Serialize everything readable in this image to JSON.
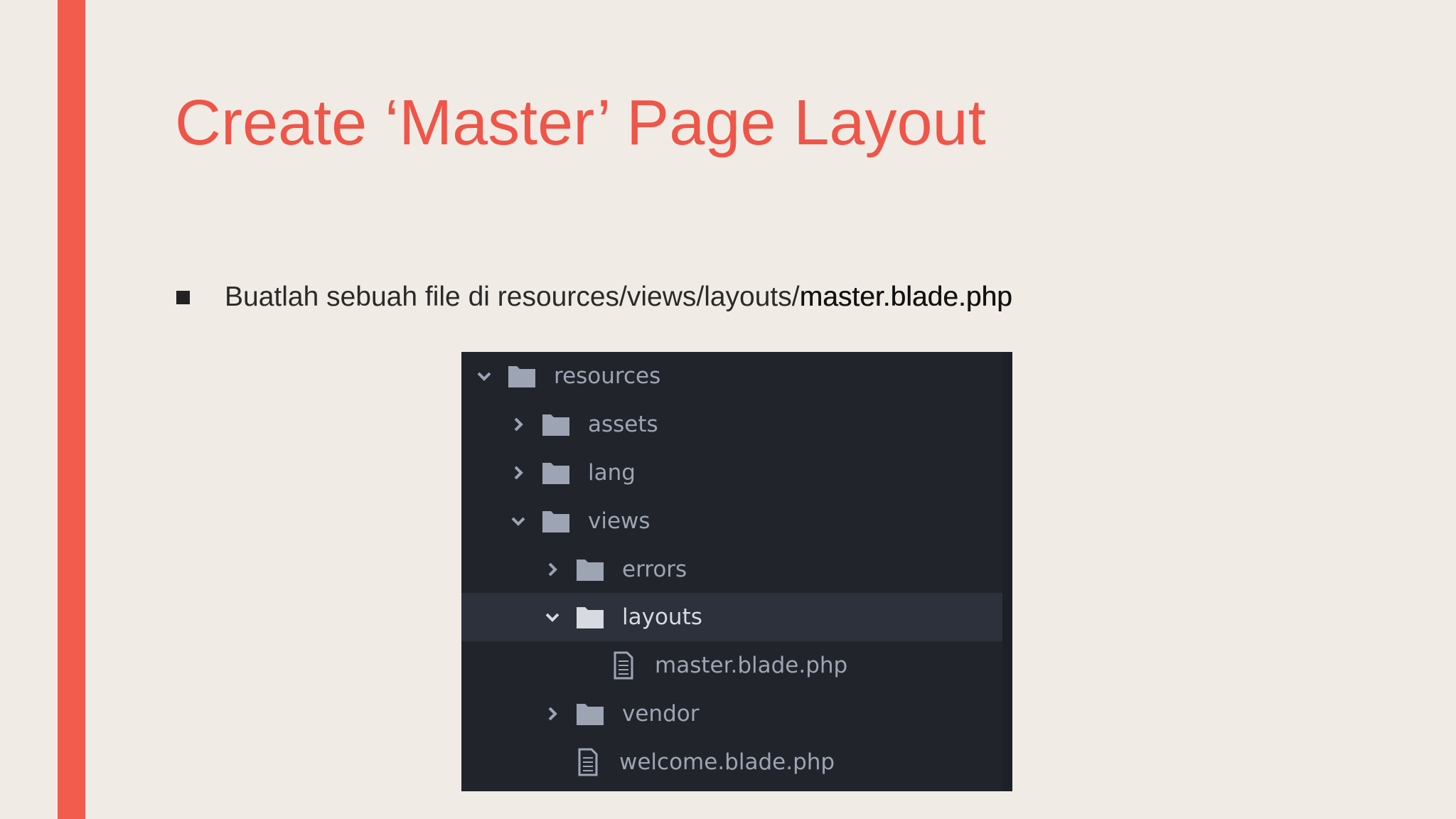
{
  "slide": {
    "title": "Create ‘Master’ Page Layout",
    "bullet": {
      "prefix": "Buatlah sebuah file di resources/views/layouts/",
      "emphasis": "master.blade.php"
    },
    "accent_color": "#f25c4c",
    "title_color": "#ef5548",
    "background_color": "#f0ece5"
  },
  "tree": {
    "items": [
      {
        "label": "resources",
        "type": "folder",
        "state": "expanded"
      },
      {
        "label": "assets",
        "type": "folder",
        "state": "collapsed"
      },
      {
        "label": "lang",
        "type": "folder",
        "state": "collapsed"
      },
      {
        "label": "views",
        "type": "folder",
        "state": "expanded"
      },
      {
        "label": "errors",
        "type": "folder",
        "state": "collapsed"
      },
      {
        "label": "layouts",
        "type": "folder",
        "state": "expanded",
        "selected": true
      },
      {
        "label": "master.blade.php",
        "type": "file"
      },
      {
        "label": "vendor",
        "type": "folder",
        "state": "collapsed"
      },
      {
        "label": "welcome.blade.php",
        "type": "file"
      }
    ],
    "background_color": "#21252b",
    "selected_color": "#2c313c"
  }
}
